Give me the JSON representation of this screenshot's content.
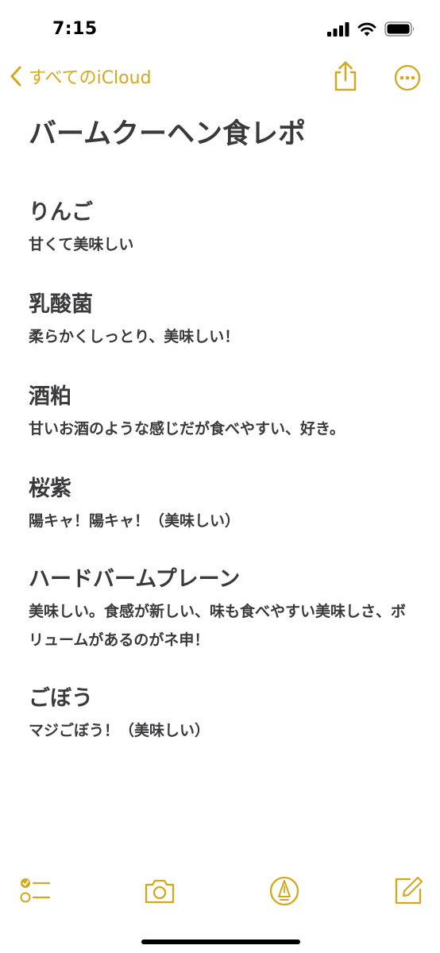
{
  "status_bar": {
    "time": "7:15"
  },
  "nav": {
    "back_label": "すべてのiCloud"
  },
  "note": {
    "title": "バームクーヘン食レポ",
    "sections": [
      {
        "heading": "りんご",
        "body": "甘くて美味しい"
      },
      {
        "heading": "乳酸菌",
        "body": "柔らかくしっとり、美味しい！"
      },
      {
        "heading": "酒粕",
        "body": "甘いお酒のような感じだが食べやすい、好き。"
      },
      {
        "heading": "桜紫",
        "body": "陽キャ！陽キャ！（美味しい）"
      },
      {
        "heading": "ハードバームプレーン",
        "body": "美味しい。食感が新しい、味も食べやすい美味しさ、ボリュームがあるのがネ申！"
      },
      {
        "heading": "ごぼう",
        "body": "マジごぼう！（美味しい）"
      }
    ]
  },
  "theme": {
    "accent": "#d4a81d",
    "text": "#3a3a3c",
    "background": "#ffffff"
  },
  "icons": {
    "back": "chevron-left-icon",
    "share": "share-icon",
    "more": "more-icon",
    "checklist": "checklist-icon",
    "camera": "camera-icon",
    "markup": "pen-tip-icon",
    "compose": "compose-icon",
    "signal": "signal-icon",
    "wifi": "wifi-icon",
    "battery": "battery-icon"
  }
}
